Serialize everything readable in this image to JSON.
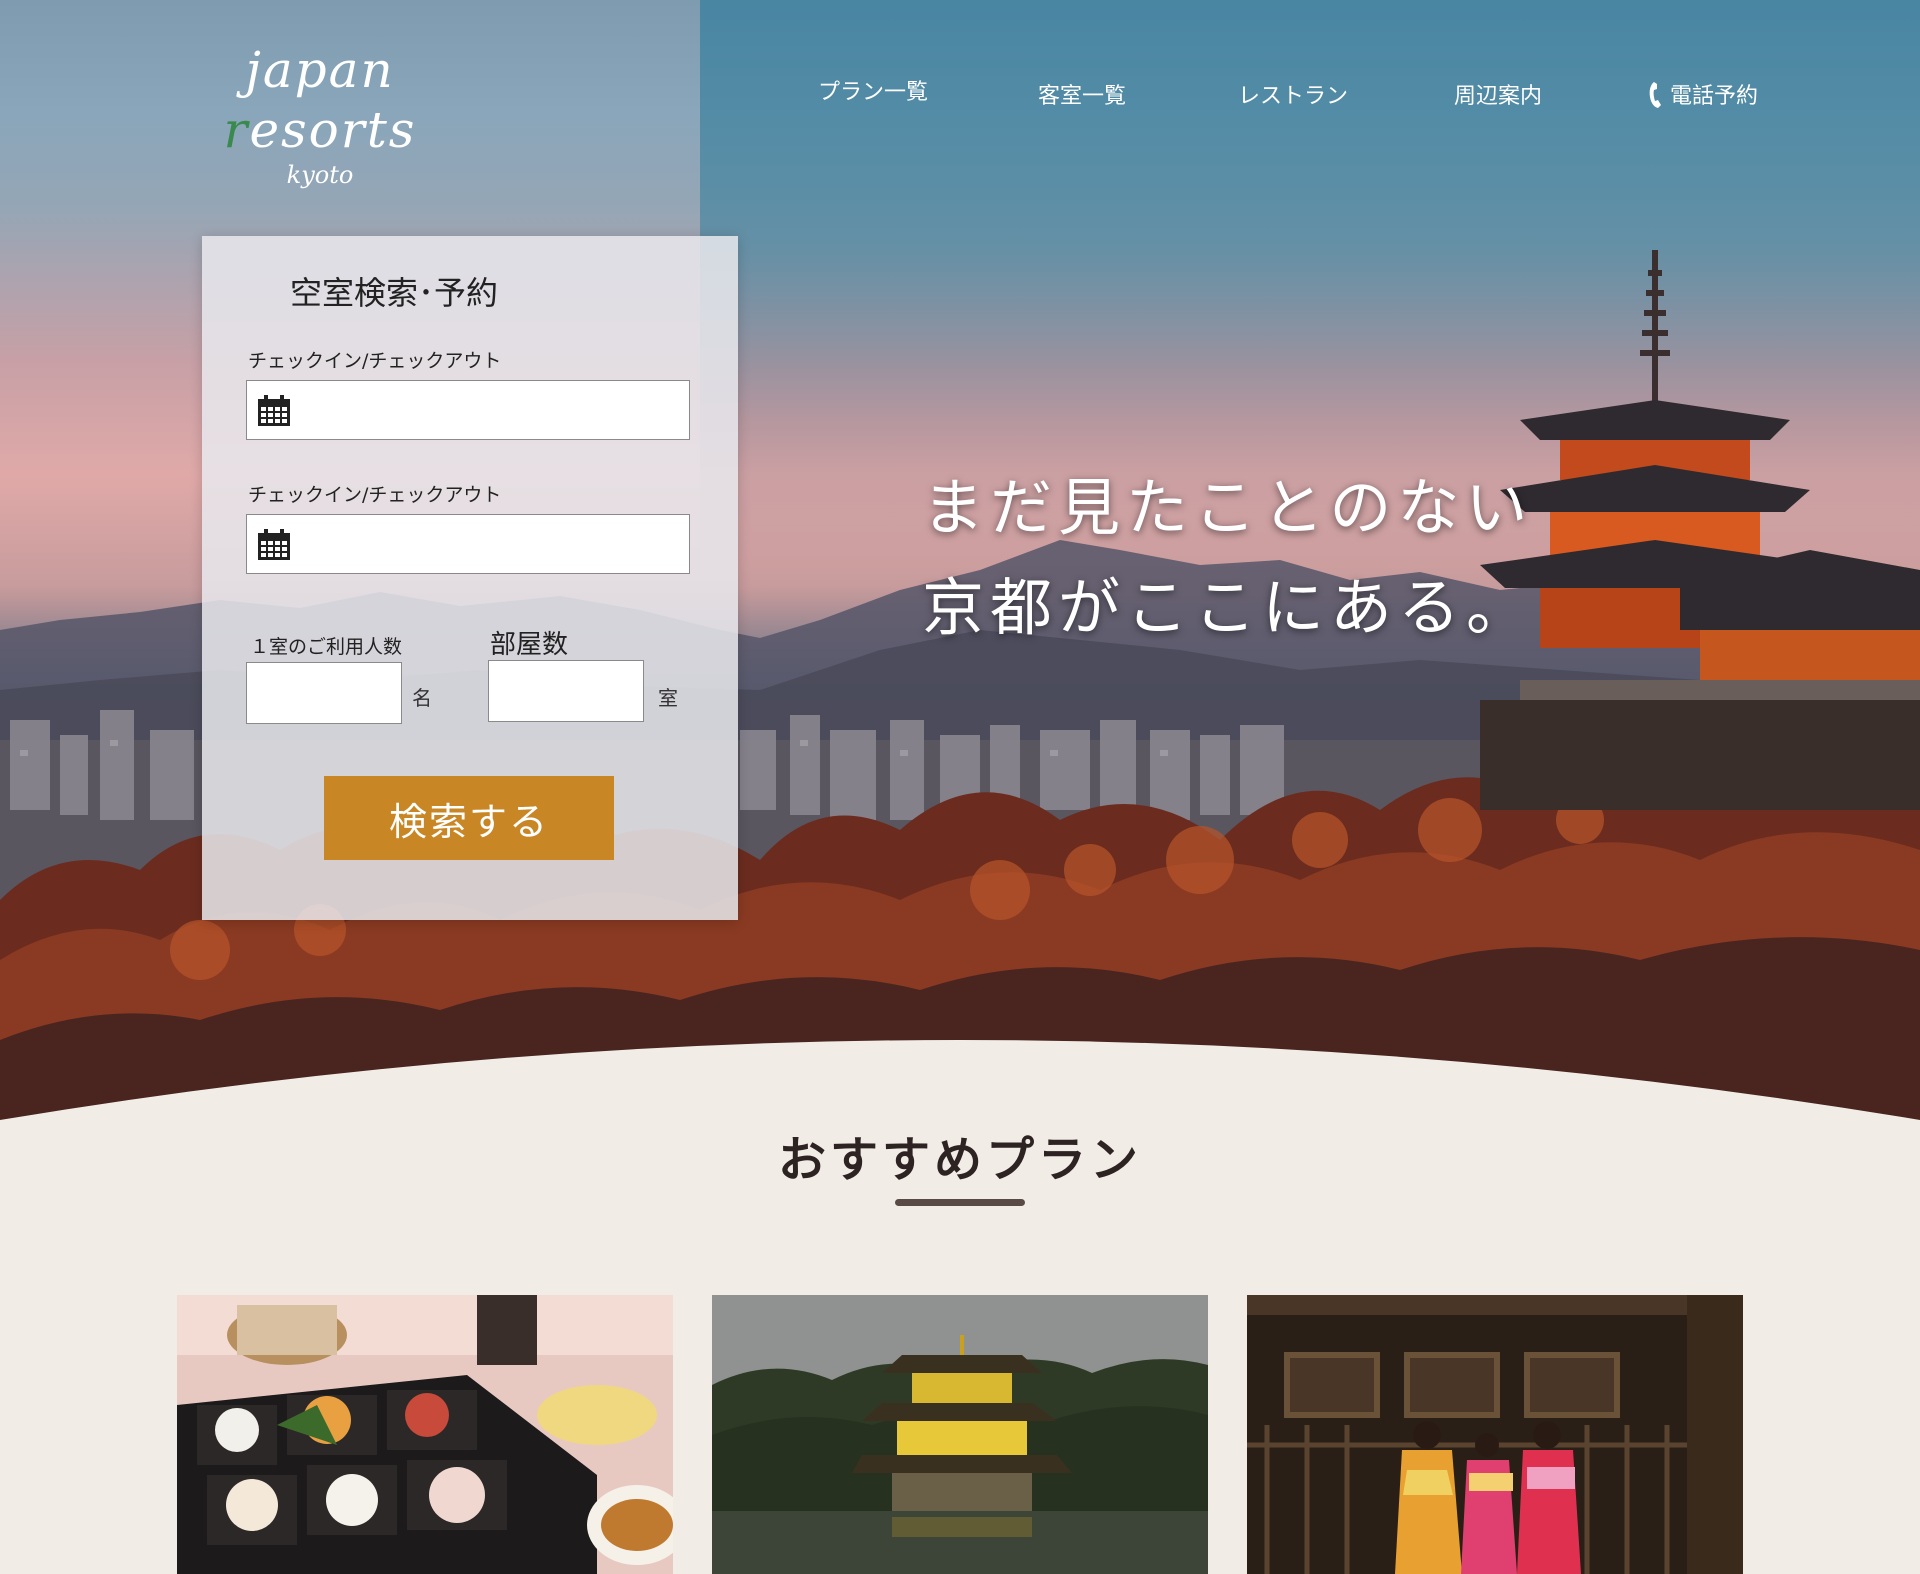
{
  "header": {
    "logo_main_prefix": "japan ",
    "logo_accent_letter": "r",
    "logo_main_suffix": "esorts",
    "logo_sub": "kyoto",
    "nav": [
      {
        "label": "プラン一覧"
      },
      {
        "label": "客室一覧"
      },
      {
        "label": "レストラン"
      },
      {
        "label": "周辺案内"
      },
      {
        "label": "電話予約",
        "icon": "phone-icon"
      }
    ]
  },
  "search": {
    "title": "空室検索･予約",
    "checkin_label": "チェックイン/チェックアウト",
    "checkout_label": "チェックイン/チェックアウト",
    "checkin_value": "",
    "checkout_value": "",
    "guests_label": "１室のご利用人数",
    "guests_unit": "名",
    "guests_value": "",
    "rooms_label": "部屋数",
    "rooms_unit": "室",
    "rooms_value": "",
    "submit_label": "検索する"
  },
  "hero": {
    "line1": "まだ見たことのない",
    "line2": "京都がここにある。"
  },
  "recommended": {
    "title": "おすすめプラン",
    "cards": [
      {
        "image": "kaiseki-bento-photo"
      },
      {
        "image": "kinkakuji-golden-pavilion-photo"
      },
      {
        "image": "kimono-women-photo"
      }
    ]
  },
  "colors": {
    "accent_button": "#c98624",
    "logo_accent": "#3a8a4e",
    "page_background": "#f1ede6",
    "title_underline": "#5a4a45"
  }
}
